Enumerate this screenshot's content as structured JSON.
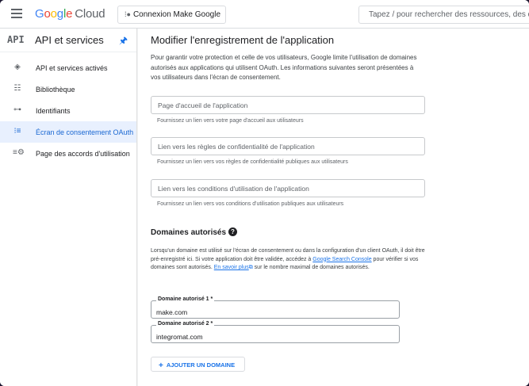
{
  "topbar": {
    "brand_google": [
      "G",
      "o",
      "o",
      "g",
      "l",
      "e"
    ],
    "brand_cloud": "Cloud",
    "project_label": "Connexion Make Google",
    "search_placeholder": "Tapez / pour rechercher des ressources, des d"
  },
  "sidebar": {
    "badge": "API",
    "title": "API et services",
    "items": [
      {
        "label": "API et services activés",
        "icon": "api-diamond-icon"
      },
      {
        "label": "Bibliothèque",
        "icon": "library-icon"
      },
      {
        "label": "Identifiants",
        "icon": "key-icon"
      },
      {
        "label": "Écran de consentement OAuth",
        "icon": "consent-screen-icon",
        "active": true
      },
      {
        "label": "Page des accords d'utilisation",
        "icon": "agreements-icon"
      }
    ]
  },
  "main": {
    "title": "Modifier l'enregistrement de l'application",
    "intro": "Pour garantir votre protection et celle de vos utilisateurs, Google limite l'utilisation de domaines autorisés aux applications qui utilisent OAuth. Les informations suivantes seront présentées à vos utilisateurs dans l'écran de consentement.",
    "fields": [
      {
        "placeholder": "Page d'accueil de l'application",
        "hint": "Fournissez un lien vers votre page d'accueil aux utilisateurs"
      },
      {
        "placeholder": "Lien vers les règles de confidentialité de l'application",
        "hint": "Fournissez un lien vers vos règles de confidentialité publiques aux utilisateurs"
      },
      {
        "placeholder": "Lien vers les conditions d'utilisation de l'application",
        "hint": "Fournissez un lien vers vos conditions d'utilisation publiques aux utilisateurs"
      }
    ],
    "domains": {
      "title": "Domaines autorisés",
      "desc_1": "Lorsqu'un domaine est utilisé sur l'écran de consentement ou dans la configuration d'un client OAuth, il doit être pré-enregistré ici. Si votre application doit être validée, accédez à ",
      "link_console": "Google Search Console",
      "desc_2": " pour vérifier si vos domaines sont autorisés. ",
      "link_more": "En savoir plus",
      "desc_3": " sur le nombre maximal de domaines autorisés.",
      "entries": [
        {
          "label": "Domaine autorisé 1 *",
          "value": "make.com"
        },
        {
          "label": "Domaine autorisé 2 *",
          "value": "integromat.com"
        }
      ],
      "add_label": "AJOUTER UN DOMAINE"
    }
  },
  "colors": {
    "accent": "#1a73e8",
    "active_bg": "#e8f0fe"
  }
}
